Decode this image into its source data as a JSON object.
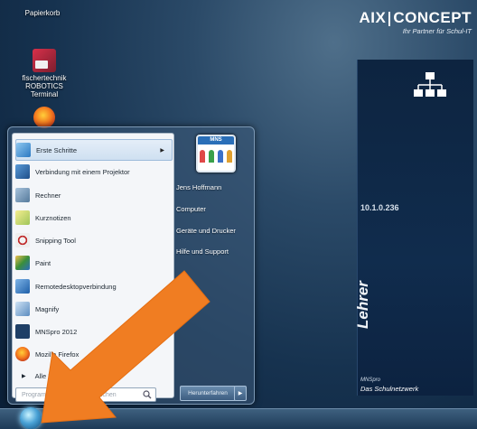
{
  "desktop": {
    "icons": [
      {
        "label": "Papierkorb",
        "icon": "recycle-bin-icon"
      },
      {
        "label": "fischertechnik ROBOTICS Terminal",
        "icon": "robotics-icon"
      },
      {
        "label": "",
        "icon": "firefox-icon"
      }
    ],
    "brand": {
      "logo_left": "AIX",
      "logo_right": "CONCEPT",
      "tagline": "Ihr Partner für Schul-IT"
    },
    "panel": {
      "ip_line1": "",
      "ip_line2": "",
      "ip_bold": "10.1.0.236",
      "role_label": "Lehrer",
      "product": "MNSpro",
      "product_tagline": "Das Schulnetzwerk"
    }
  },
  "start_menu": {
    "programs": [
      {
        "label": "Erste Schritte",
        "icon": "getting-started-icon",
        "has_submenu": true
      },
      {
        "label": "Verbindung mit einem Projektor",
        "icon": "projector-icon",
        "has_submenu": false
      },
      {
        "label": "Rechner",
        "icon": "calculator-icon",
        "has_submenu": false
      },
      {
        "label": "Kurznotizen",
        "icon": "sticky-notes-icon",
        "has_submenu": false
      },
      {
        "label": "Snipping Tool",
        "icon": "snipping-tool-icon",
        "has_submenu": false
      },
      {
        "label": "Paint",
        "icon": "paint-icon",
        "has_submenu": false
      },
      {
        "label": "Remotedesktopverbindung",
        "icon": "remote-desktop-icon",
        "has_submenu": false
      },
      {
        "label": "Magnify",
        "icon": "magnifier-icon",
        "has_submenu": false
      },
      {
        "label": "MNSpro 2012",
        "icon": "mnspro-icon",
        "has_submenu": false
      },
      {
        "label": "Mozilla Firefox",
        "icon": "firefox-icon",
        "has_submenu": false
      }
    ],
    "all_programs_label": "Alle Programme",
    "search_placeholder": "Programme/Dateien durchsuchen",
    "right_items": [
      {
        "label": "Jens Hoffmann"
      },
      {
        "label": "Computer"
      },
      {
        "label": "Geräte und Drucker"
      },
      {
        "label": "Hilfe und Support"
      }
    ],
    "user_picture_label": "MNS",
    "shutdown_label": "Herunterfahren"
  },
  "colors": {
    "accent_arrow": "#f07d22",
    "taskbar": "#2a4a6a"
  }
}
